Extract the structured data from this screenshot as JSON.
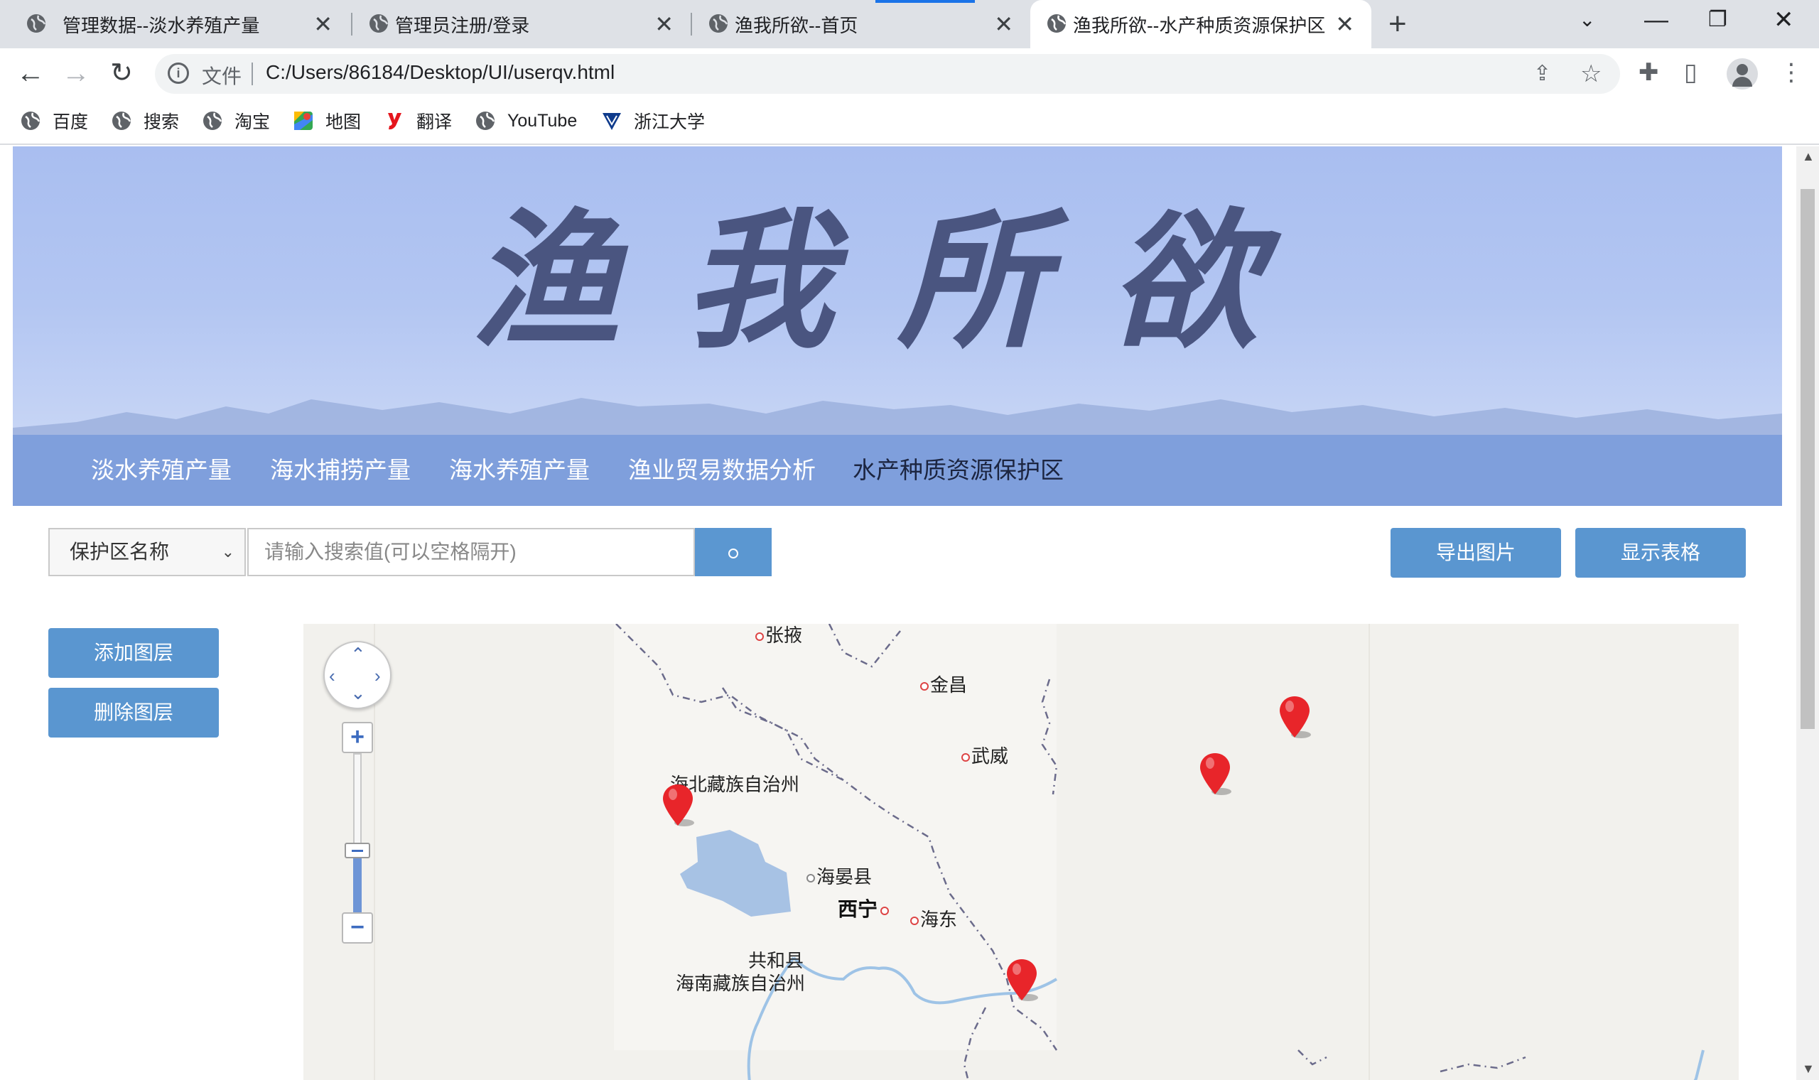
{
  "browser": {
    "tabs": [
      {
        "title": "管理数据--淡水养殖产量",
        "close": "✕",
        "active": false
      },
      {
        "title": "管理员注册/登录",
        "close": "✕",
        "active": false
      },
      {
        "title": "渔我所欲--首页",
        "close": "✕",
        "active": false
      },
      {
        "title": "渔我所欲--水产种质资源保护区",
        "close": "✕",
        "active": true
      }
    ],
    "new_tab": "+",
    "address": {
      "label": "文件",
      "url": "C:/Users/86184/Desktop/UI/userqv.html"
    },
    "bookmarks": [
      {
        "label": "百度",
        "icon": "globe-icon"
      },
      {
        "label": "搜索",
        "icon": "globe-icon"
      },
      {
        "label": "淘宝",
        "icon": "globe-icon"
      },
      {
        "label": "地图",
        "icon": "maps-icon"
      },
      {
        "label": "翻译",
        "icon": "youdao-icon"
      },
      {
        "label": "YouTube",
        "icon": "globe-icon"
      },
      {
        "label": "浙江大学",
        "icon": "zju-icon"
      }
    ]
  },
  "banner": {
    "title": "渔我所欲"
  },
  "nav": {
    "items": [
      "淡水养殖产量",
      "海水捕捞产量",
      "海水养殖产量",
      "渔业贸易数据分析",
      "水产种质资源保护区"
    ],
    "current_index": 4
  },
  "search": {
    "field_select": "保护区名称",
    "placeholder": "请输入搜索值(可以空格隔开)"
  },
  "actions": {
    "export_image": "导出图片",
    "show_table": "显示表格"
  },
  "layers": {
    "add": "添加图层",
    "delete": "删除图层"
  },
  "map": {
    "labels": {
      "zhangye": "张掖",
      "jinchang": "金昌",
      "wuwei": "武威",
      "haibei": "海北藏族自治州",
      "haiyan": "海晏县",
      "xining": "西宁",
      "haidong": "海东",
      "gonghe": "共和县",
      "hainan": "海南藏族自治州"
    },
    "markers_count": 4,
    "zoom_level_fraction": 0.6
  },
  "colors": {
    "nav_bg": "#7f9fdc",
    "button_blue": "#5a96d0",
    "marker_red": "#e8252a",
    "lake_blue": "#a7c2e4"
  }
}
